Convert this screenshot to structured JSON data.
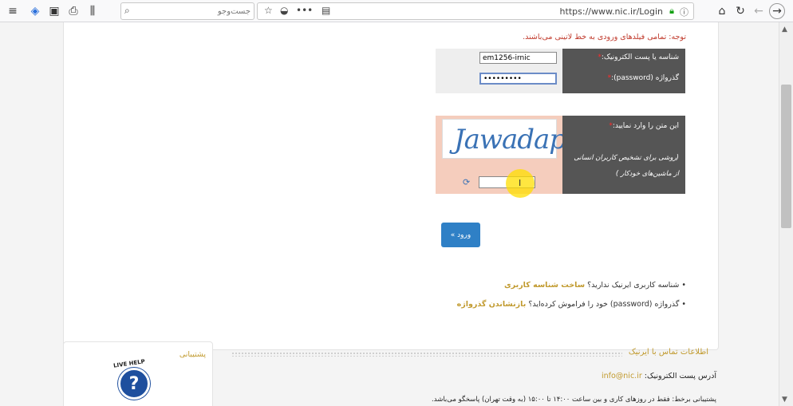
{
  "browser": {
    "search_placeholder": "جست‌وجو",
    "url": "https://www.nic.ir/Login"
  },
  "form": {
    "note": "توجه: تمامی فیلدهای ورودی به خط لاتینی می‌باشند.",
    "username_label": "شناسه یا پست الکترونیک:",
    "username_value": "em1256-irnic",
    "password_label": "گذرواژه (password):",
    "password_value": "•••••••••",
    "captcha_label": "این متن را وارد نمایید:",
    "captcha_hint_1": "(روشی برای تشخیص کاربران انسانی",
    "captcha_hint_2": "از ماشین‌های خودکار )",
    "captcha_text": "Jawadap",
    "captcha_value": "",
    "submit_label": "ورود »",
    "required_mark": "*"
  },
  "links": {
    "no_account_text": "• شناسه کاربری ایرنیک ندارید؟",
    "create_account": "ساخت شناسه کاربری",
    "forgot_text": "• گذرواژه (password) خود را فراموش کرده‌اید؟",
    "reset_password": "بازنشاندن گذرواژه"
  },
  "support": {
    "title": "پشتیبانی",
    "livehelp_text": "LIVE HELP"
  },
  "contact": {
    "title": "اطلاعات تماس با ایرنیک",
    "email_label": "آدرس پست الکترونیک:",
    "email": "info@nic.ir",
    "hours": "پشتیبانی برخط: فقط در روزهای کاری و بین ساعت ۱۴:۰۰ تا ۱۵:۰۰ (به وقت تهران) پاسخگو می‌باشد."
  }
}
